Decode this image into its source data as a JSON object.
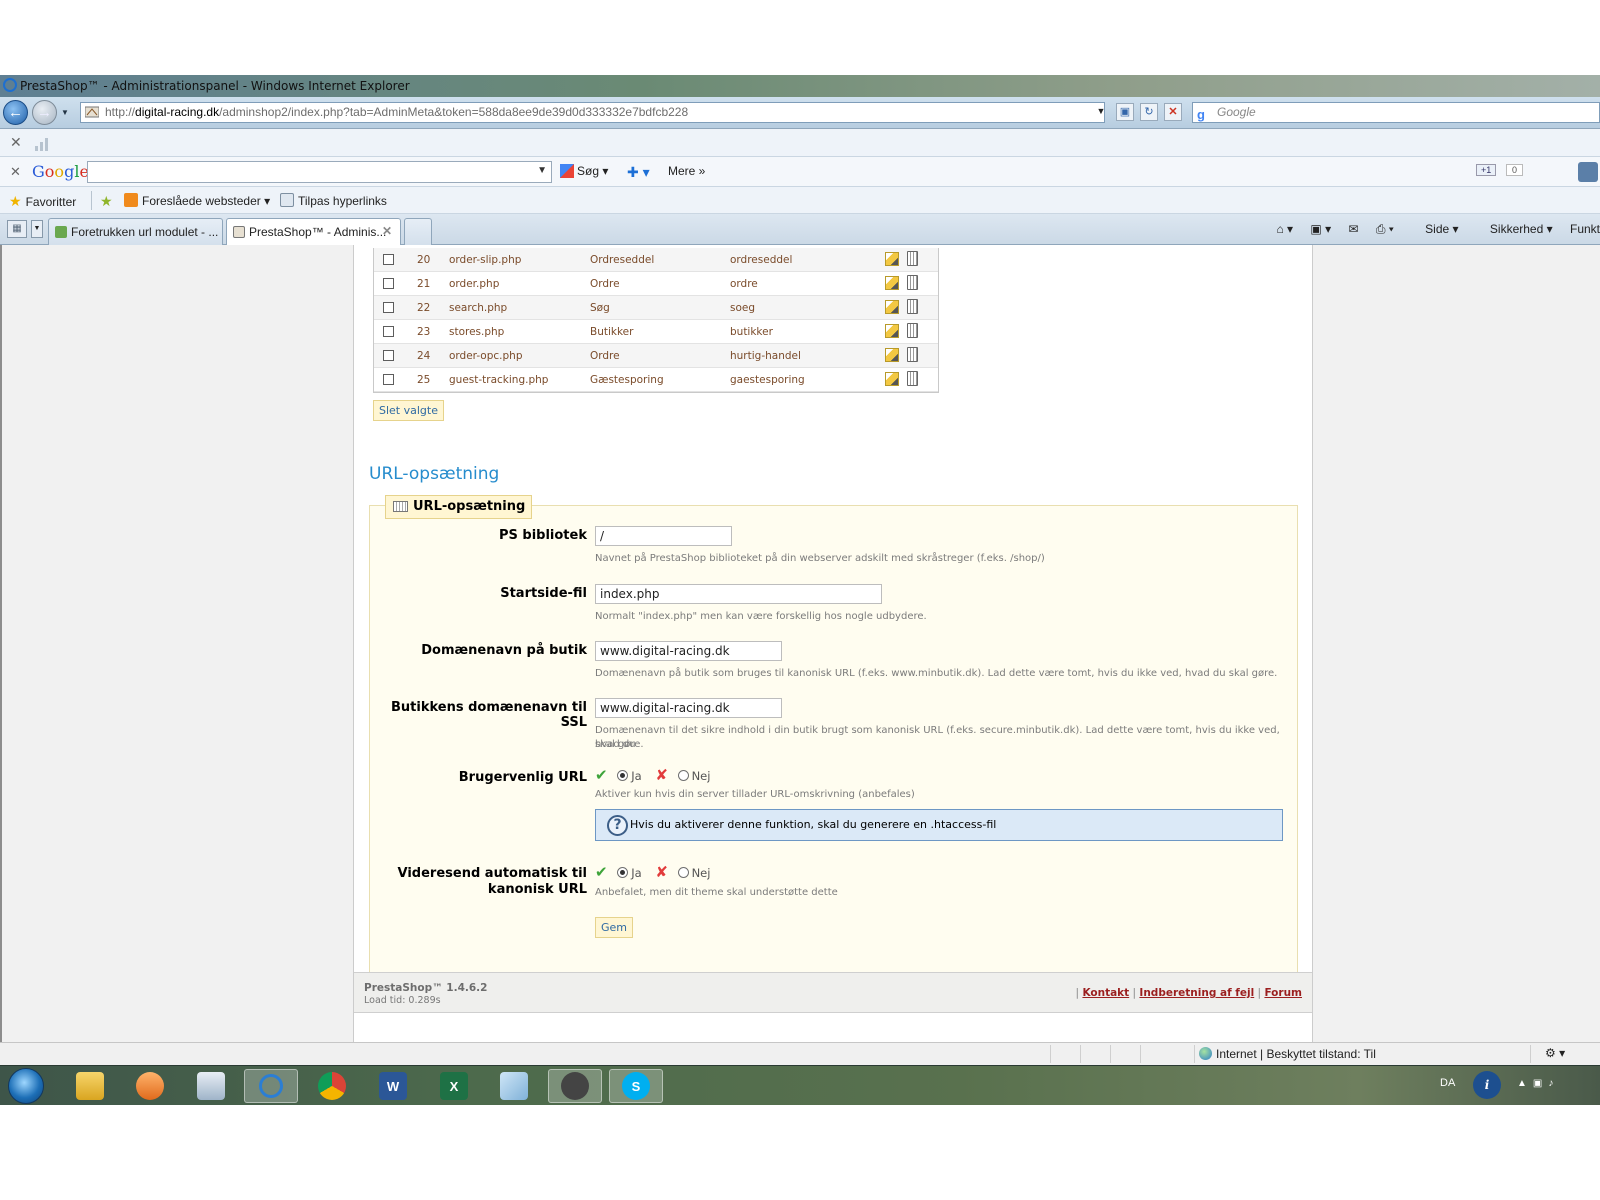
{
  "window": {
    "title": "PrestaShop™ - Administrationspanel - Windows Internet Explorer",
    "url_prefix": "http://",
    "url_host": "digital-racing.dk",
    "url_path": "/adminshop2/index.php?tab=AdminMeta&token=588da8ee9de39d0d333332e7bdfcb228",
    "search_placeholder": "Google"
  },
  "google_toolbar": {
    "logo_g": "G",
    "logo_o1": "o",
    "logo_o2": "o",
    "logo_g2": "g",
    "logo_l": "l",
    "logo_e": "e",
    "search_label": "Søg",
    "more_label": "Mere »",
    "plus_one": "+1",
    "plus_count": "0"
  },
  "favorites": {
    "favorites_label": "Favoritter",
    "suggested_label": "Foreslåede websteder",
    "links_label": "Tilpas hyperlinks"
  },
  "tabs": [
    {
      "label": "Foretrukken url modulet - ..."
    },
    {
      "label": "PrestaShop™ - Adminis..."
    }
  ],
  "commandbar": {
    "page": "Side",
    "security": "Sikkerhed",
    "tools": "Funkt"
  },
  "table": {
    "rows": [
      {
        "id": "20",
        "page": "order-slip.php",
        "title": "Ordreseddel",
        "url": "ordreseddel"
      },
      {
        "id": "21",
        "page": "order.php",
        "title": "Ordre",
        "url": "ordre"
      },
      {
        "id": "22",
        "page": "search.php",
        "title": "Søg",
        "url": "soeg"
      },
      {
        "id": "23",
        "page": "stores.php",
        "title": "Butikker",
        "url": "butikker"
      },
      {
        "id": "24",
        "page": "order-opc.php",
        "title": "Ordre",
        "url": "hurtig-handel"
      },
      {
        "id": "25",
        "page": "guest-tracking.php",
        "title": "Gæstesporing",
        "url": "gaestesporing"
      }
    ],
    "delete_selected": "Slet valgte"
  },
  "section_title": "URL-opsætning",
  "fieldset": {
    "legend": "URL-opsætning",
    "ps_dir": {
      "label": "PS bibliotek",
      "value": "/",
      "hint": "Navnet på PrestaShop biblioteket på din webserver adskilt med skråstreger (f.eks. /shop/)"
    },
    "home_file": {
      "label": "Startside-fil",
      "value": "index.php",
      "hint": "Normalt \"index.php\" men kan være forskellig hos nogle udbydere."
    },
    "domain": {
      "label": "Domænenavn på butik",
      "value": "www.digital-racing.dk",
      "hint": "Domænenavn på butik som bruges til kanonisk URL (f.eks. www.minbutik.dk). Lad dette være tomt, hvis du ikke ved, hvad du skal gøre."
    },
    "domain_ssl": {
      "label": "Butikkens domænenavn til SSL",
      "value": "www.digital-racing.dk",
      "hint_1": "Domænenavn til det sikre indhold i din butik brugt som kanonisk URL (f.eks. secure.minbutik.dk). Lad dette være tomt, hvis du ikke ved, hvad du",
      "hint_2": "skal gøre."
    },
    "friendly_url": {
      "label": "Brugervenlig URL",
      "yes": "Ja",
      "no": "Nej",
      "selected": "Ja",
      "hint": "Aktiver kun hvis din server tillader URL-omskrivning (anbefales)"
    },
    "info": {
      "text": "Hvis du aktiverer denne funktion, skal du",
      "link": "generere en .htaccess-fil"
    },
    "canonical": {
      "label_1": "Videresend automatisk til",
      "label_2": "kanonisk URL",
      "yes": "Ja",
      "no": "Nej",
      "selected": "Ja",
      "hint": "Anbefalet, men dit theme skal understøtte dette"
    },
    "save": "Gem"
  },
  "footer": {
    "version": "PrestaShop™ 1.4.6.2",
    "load_time": "Load tid: 0.289s",
    "sep": "|",
    "contact": "Kontakt",
    "bug": "Indberetning af fejl",
    "forum": "Forum"
  },
  "statusbar": {
    "zone": "Internet | Beskyttet tilstand: Til"
  },
  "taskbar": {
    "language": "DA"
  }
}
